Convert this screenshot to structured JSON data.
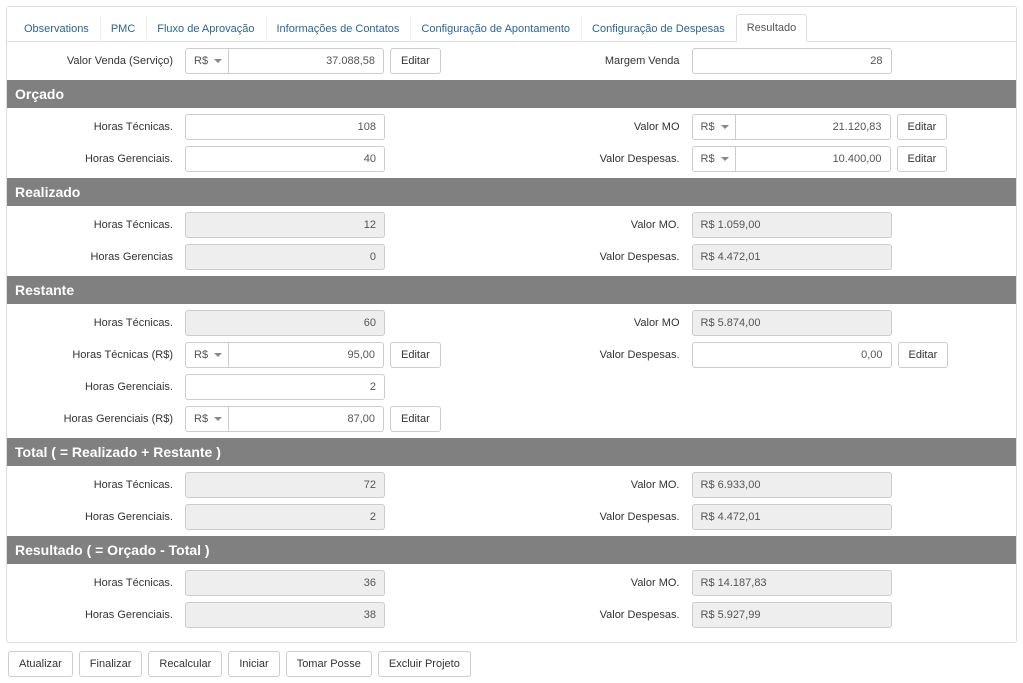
{
  "tabs": {
    "observations": "Observations",
    "pmc": "PMC",
    "fluxo": "Fluxo de Aprovação",
    "info": "Informações de Contatos",
    "apontamento": "Configuração de Apontamento",
    "despesas": "Configuração de Despesas",
    "resultado": "Resultado"
  },
  "currency": "R$",
  "btn_editar": "Editar",
  "header": {
    "valor_venda_label": "Valor Venda (Serviço)",
    "valor_venda": "37.088,58",
    "margem_venda_label": "Margem Venda",
    "margem_venda": "28"
  },
  "orcado": {
    "title": "Orçado",
    "horas_tec_label": "Horas Técnicas.",
    "horas_tec": "108",
    "valor_mo_label": "Valor MO",
    "valor_mo": "21.120,83",
    "horas_ger_label": "Horas Gerenciais.",
    "horas_ger": "40",
    "valor_desp_label": "Valor Despesas.",
    "valor_desp": "10.400,00"
  },
  "realizado": {
    "title": "Realizado",
    "horas_tec_label": "Horas Técnicas.",
    "horas_tec": "12",
    "valor_mo_label": "Valor MO.",
    "valor_mo": "R$ 1.059,00",
    "horas_ger_label": "Horas Gerencias",
    "horas_ger": "0",
    "valor_desp_label": "Valor Despesas.",
    "valor_desp": "R$ 4.472,01"
  },
  "restante": {
    "title": "Restante",
    "horas_tec_label": "Horas Técnicas.",
    "horas_tec": "60",
    "valor_mo_label": "Valor MO",
    "valor_mo": "R$ 5.874,00",
    "horas_tec_rs_label": "Horas Técnicas (R$)",
    "horas_tec_rs": "95,00",
    "valor_desp_label": "Valor Despesas.",
    "valor_desp": "0,00",
    "horas_ger_label": "Horas Gerenciais.",
    "horas_ger": "2",
    "horas_ger_rs_label": "Horas Gerenciais (R$)",
    "horas_ger_rs": "87,00"
  },
  "total": {
    "title": "Total ( = Realizado + Restante )",
    "horas_tec_label": "Horas Técnicas.",
    "horas_tec": "72",
    "valor_mo_label": "Valor MO.",
    "valor_mo": "R$ 6.933,00",
    "horas_ger_label": "Horas Gerenciais.",
    "horas_ger": "2",
    "valor_desp_label": "Valor Despesas.",
    "valor_desp": "R$ 4.472,01"
  },
  "resultado": {
    "title": "Resultado ( = Orçado - Total )",
    "horas_tec_label": "Horas Técnicas.",
    "horas_tec": "36",
    "valor_mo_label": "Valor MO.",
    "valor_mo": "R$ 14.187,83",
    "horas_ger_label": "Horas Gerenciais.",
    "horas_ger": "38",
    "valor_desp_label": "Valor Despesas.",
    "valor_desp": "R$ 5.927,99"
  },
  "footer": {
    "atualizar": "Atualizar",
    "finalizar": "Finalizar",
    "recalcular": "Recalcular",
    "iniciar": "Iniciar",
    "tomar_posse": "Tomar Posse",
    "excluir": "Excluir Projeto"
  }
}
